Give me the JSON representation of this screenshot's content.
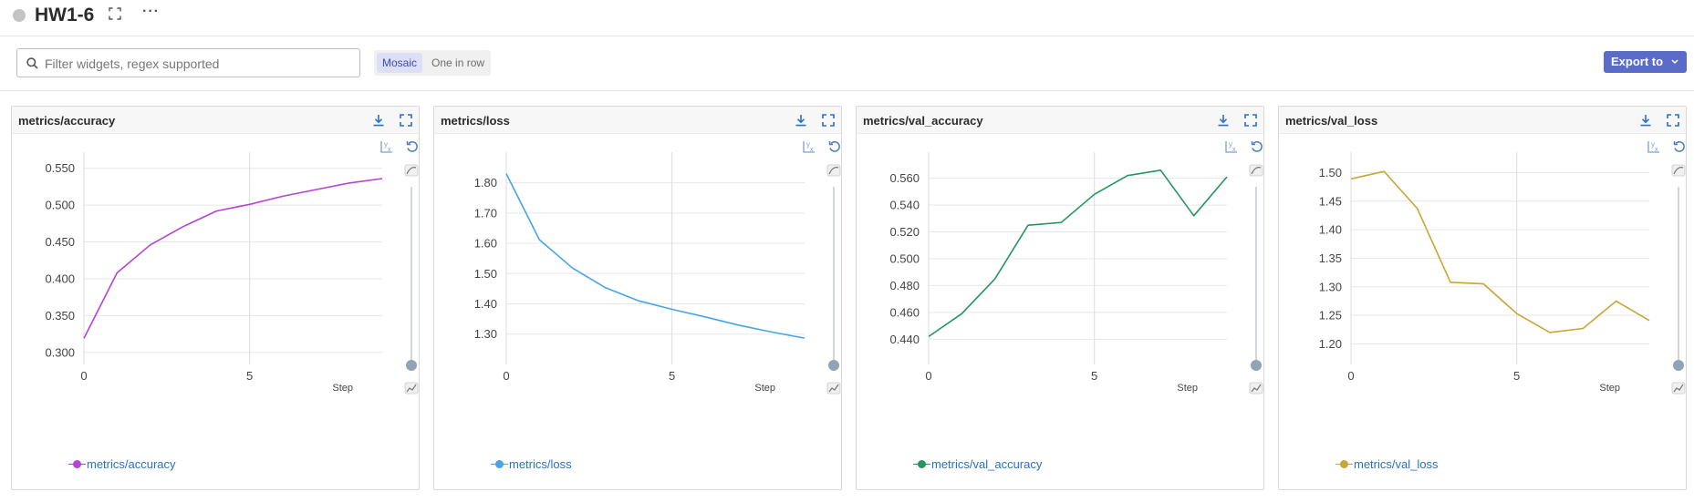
{
  "header": {
    "title": "HW1-6"
  },
  "toolbar": {
    "search_placeholder": "Filter widgets, regex supported",
    "view_options": [
      "Mosaic",
      "One in row"
    ],
    "active_view": "Mosaic",
    "export_label": "Export to"
  },
  "colors": {
    "accent": "#5a6bc8",
    "link": "#2a6fc9"
  },
  "panels": [
    {
      "title": "metrics/accuracy",
      "legend": "metrics/accuracy",
      "color": "#b543d6"
    },
    {
      "title": "metrics/loss",
      "legend": "metrics/loss",
      "color": "#47a4e8"
    },
    {
      "title": "metrics/val_accuracy",
      "legend": "metrics/val_accuracy",
      "color": "#23955f"
    },
    {
      "title": "metrics/val_loss",
      "legend": "metrics/val_loss",
      "color": "#c9a535"
    }
  ],
  "chart_data": [
    {
      "type": "line",
      "xlabel": "Step",
      "x": [
        0,
        1,
        2,
        3,
        4,
        5,
        6,
        7,
        8,
        9
      ],
      "xticks": [
        0,
        5
      ],
      "xlim": [
        0,
        9
      ],
      "yticks": [
        "0.300",
        "0.350",
        "0.400",
        "0.450",
        "0.500",
        "0.550"
      ],
      "ylim": [
        0.296,
        0.562
      ],
      "series": [
        {
          "name": "metrics/accuracy",
          "color": "#b543d6",
          "values": [
            0.319,
            0.408,
            0.446,
            0.471,
            0.492,
            0.501,
            0.512,
            0.521,
            0.53,
            0.536
          ]
        }
      ]
    },
    {
      "type": "line",
      "xlabel": "Step",
      "x": [
        0,
        1,
        2,
        3,
        4,
        5,
        6,
        7,
        8,
        9
      ],
      "xticks": [
        0,
        5
      ],
      "xlim": [
        0,
        9
      ],
      "yticks": [
        "1.30",
        "1.40",
        "1.50",
        "1.60",
        "1.70",
        "1.80"
      ],
      "ylim": [
        1.23,
        1.877
      ],
      "series": [
        {
          "name": "metrics/loss",
          "color": "#47a4e8",
          "values": [
            1.83,
            1.612,
            1.518,
            1.453,
            1.41,
            1.382,
            1.357,
            1.33,
            1.307,
            1.287
          ]
        }
      ]
    },
    {
      "type": "line",
      "xlabel": "Step",
      "x": [
        0,
        1,
        2,
        3,
        4,
        5,
        6,
        7,
        8,
        9
      ],
      "xticks": [
        0,
        5
      ],
      "xlim": [
        0,
        9
      ],
      "yticks": [
        "0.440",
        "0.460",
        "0.480",
        "0.500",
        "0.520",
        "0.540",
        "0.560"
      ],
      "ylim": [
        0.428,
        0.574
      ],
      "series": [
        {
          "name": "metrics/val_accuracy",
          "color": "#23955f",
          "values": [
            0.442,
            0.459,
            0.485,
            0.525,
            0.527,
            0.548,
            0.562,
            0.566,
            0.532,
            0.561
          ]
        }
      ]
    },
    {
      "type": "line",
      "xlabel": "Step",
      "x": [
        0,
        1,
        2,
        3,
        4,
        5,
        6,
        7,
        8,
        9
      ],
      "xticks": [
        0,
        5
      ],
      "xlim": [
        0,
        9
      ],
      "yticks": [
        "1.20",
        "1.25",
        "1.30",
        "1.35",
        "1.40",
        "1.45",
        "1.50"
      ],
      "ylim": [
        1.18,
        1.523
      ],
      "series": [
        {
          "name": "metrics/val_loss",
          "color": "#c9a535",
          "values": [
            1.489,
            1.502,
            1.437,
            1.308,
            1.305,
            1.253,
            1.22,
            1.227,
            1.275,
            1.241
          ]
        }
      ]
    }
  ]
}
